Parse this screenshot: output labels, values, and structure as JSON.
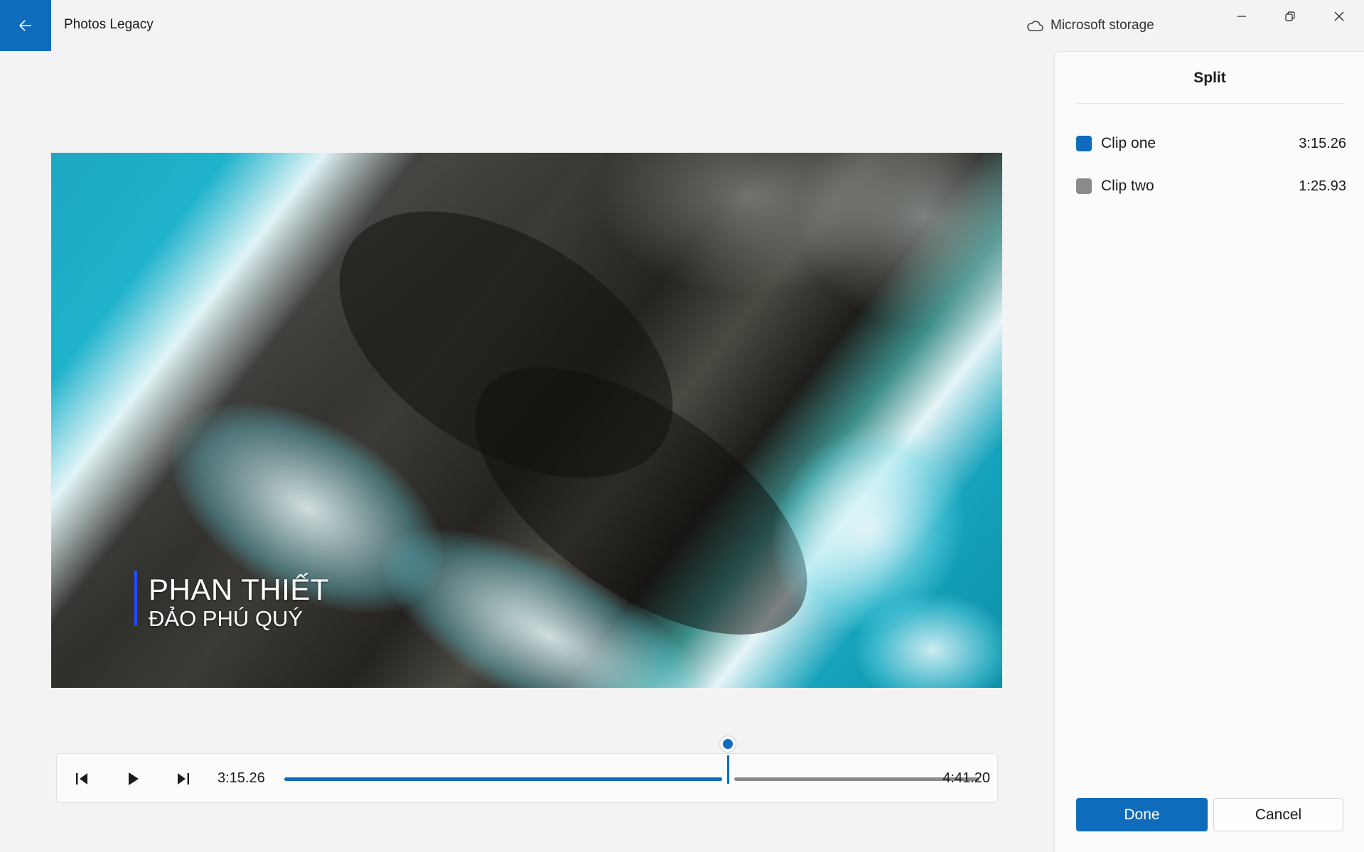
{
  "app": {
    "title": "Photos Legacy",
    "storage_label": "Microsoft storage"
  },
  "video": {
    "caption_line1": "PHAN THIẾT",
    "caption_line2": "ĐẢO PHÚ QUÝ"
  },
  "playback": {
    "current_time": "3:15.26",
    "total_time": "4:41.20",
    "progress_fraction": 0.695
  },
  "panel": {
    "title": "Split",
    "clips": [
      {
        "name": "Clip one",
        "duration": "3:15.26",
        "color": "#0f6cbd"
      },
      {
        "name": "Clip two",
        "duration": "1:25.93",
        "color": "#8a8a8a"
      }
    ],
    "done_label": "Done",
    "cancel_label": "Cancel"
  },
  "colors": {
    "accent": "#0f6cbd"
  },
  "icons": {
    "back": "arrow-left-icon",
    "storage": "cloud-icon",
    "minimize": "minimize-icon",
    "restore": "restore-icon",
    "close": "close-icon",
    "previous_frame": "step-back-icon",
    "play": "play-icon",
    "next_frame": "step-forward-icon"
  }
}
